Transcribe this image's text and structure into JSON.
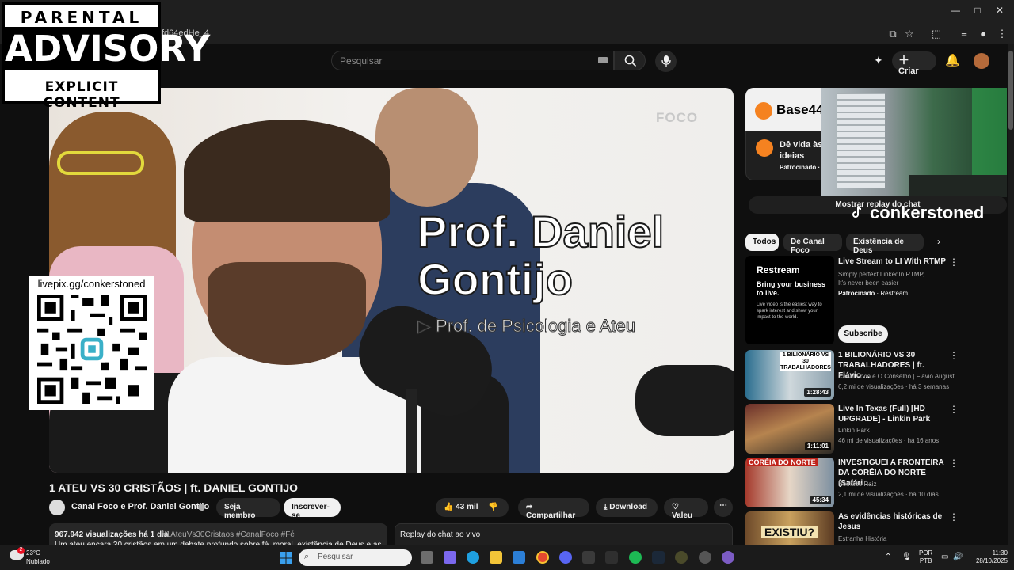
{
  "browser": {
    "url_fragment": "fd64edHe_4",
    "window_controls": {
      "minimize": "—",
      "maximize": "□",
      "close": "✕"
    }
  },
  "header": {
    "search_placeholder": "Pesquisar",
    "create_label": "Criar"
  },
  "video": {
    "brand_logo_text": "FOCO",
    "name_line_1": "Prof. Daniel",
    "name_line_2": "Gontijo",
    "role_text": "Prof. de Psicologia e Ateu"
  },
  "overlays": {
    "advisory": {
      "line_1": "PARENTAL",
      "line_2": "ADVISORY",
      "line_3": "EXPLICIT CONTENT"
    },
    "qr": {
      "label": "livepix.gg/conkerstoned"
    },
    "watermark": "conkerstoned"
  },
  "watch": {
    "title": "1 ATEU VS 30 CRISTÃOS | ft. DANIEL GONTIJO",
    "channel_name": "Canal Foco e Prof. Daniel Gontijo",
    "join_label": "Seja membro",
    "subscribe_label": "Inscrever-se",
    "likes": "43 mil",
    "share_label": "Compartilhar",
    "download_label": "Download",
    "thanks_label": "Valeu",
    "more_label": "⋯",
    "description": {
      "stats": "967.942 visualizações  há 1 dia",
      "tags": "#1AteuVs30Cristaos #CanalFoco #Fé",
      "text": "Um ateu encara 30 cristãos em um debate profundo sobre fé, moral, existência de Deus e as"
    },
    "chat_replay_label": "Replay do chat ao vivo"
  },
  "sidebar": {
    "ad": {
      "brand": "Base44",
      "headline": "Dê vida às ideias",
      "sponsored": "Patrocinado ·"
    },
    "chat_toggle": "Mostrar replay do chat",
    "chips": [
      "Todos",
      "De Canal Foco",
      "Existência de Deus"
    ],
    "chip_next": "›",
    "recommended_ad": {
      "brand": "Restream",
      "tagline": "Bring your business to live.",
      "small_text": "Live video is the easiest way to spark interest and show your impact to the world.",
      "title": "Live Stream to LI With RTMP",
      "description": "Simply perfect LinkedIn RTMP, It's never been easier",
      "sponsored": "Patrocinado",
      "advertiser": "Restream",
      "subscribe": "Subscribe"
    },
    "recommendations": [
      {
        "title": "1 BILIONÁRIO VS 30 TRABALHADORES | ft. Flávio ...",
        "channel": "Canal Foco e O Conselho | Flávio August...",
        "meta": "6,2 mi de visualizações · há 3 semanas",
        "duration": "1:28:43",
        "thumb_text": "1 BILIONÁRIO VS 30 TRABALHADORES"
      },
      {
        "title": "Live In Texas (Full) [HD UPGRADE] - Linkin Park",
        "channel": "Linkin Park",
        "meta": "46 mi de visualizações · há 16 anos",
        "duration": "1:11:01",
        "thumb_text": ""
      },
      {
        "title": "INVESTIGUEI A FRONTEIRA DA CORÉIA DO NORTE (Safári ...",
        "channel": "Nômade Raiz",
        "meta": "2,1 mi de visualizações · há 10 dias",
        "duration": "45:34",
        "thumb_text": "CORÉIA DO NORTE"
      },
      {
        "title": "As evidências históricas de Jesus",
        "channel": "Estranha História",
        "meta": "",
        "duration": "",
        "thumb_text": "EXISTIU?"
      }
    ]
  },
  "taskbar": {
    "weather_temp": "23°C",
    "weather_desc": "Nublado",
    "weather_badge": "2",
    "search_placeholder": "Pesquisar",
    "lang_line_1": "POR",
    "lang_line_2": "PTB",
    "time": "11:30",
    "date": "28/10/2025"
  },
  "colors": {
    "youtube_red": "#ff0000",
    "base44_orange": "#f58220",
    "background": "#0f0f0f"
  }
}
